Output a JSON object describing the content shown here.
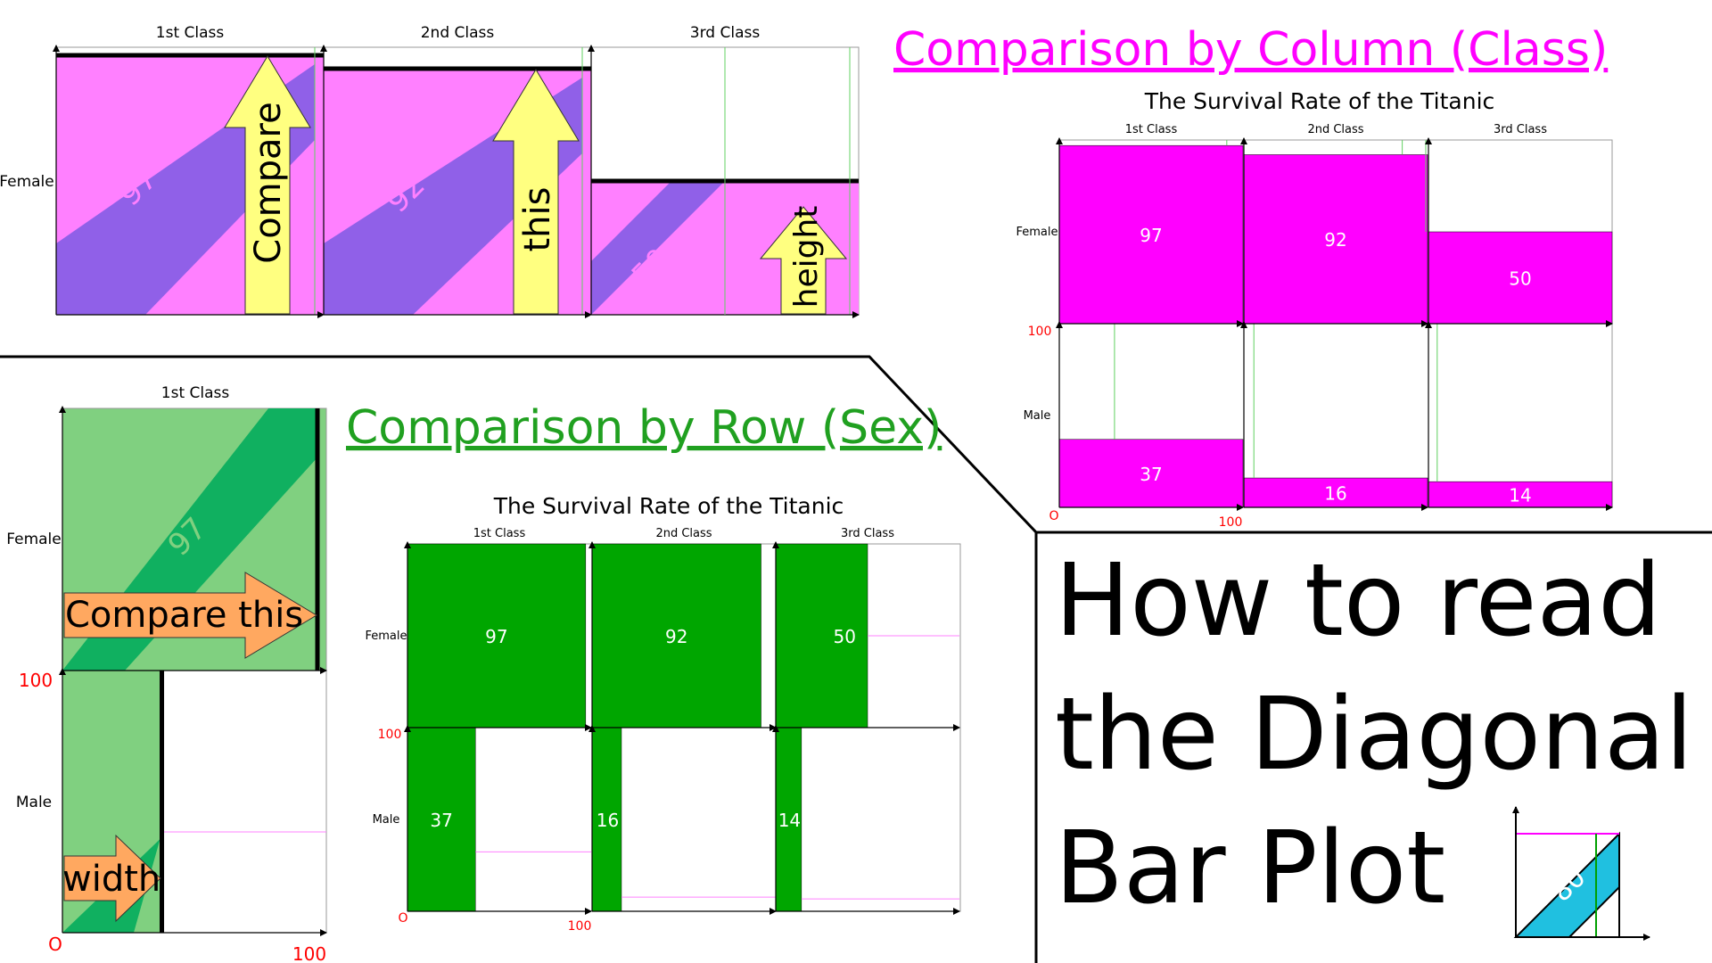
{
  "classes": [
    "1st Class",
    "2nd Class",
    "3rd Class"
  ],
  "sexes": [
    "Female",
    "Male"
  ],
  "axis": {
    "zero": "O",
    "hundred": "100"
  },
  "chart_title": "The Survival Rate of the Titanic",
  "headings": {
    "column": "Comparison by Column (Class)",
    "row": "Comparison by Row (Sex)"
  },
  "arrows": {
    "compare": "Compare",
    "this": "this",
    "height": "height",
    "compare_this": "Compare this",
    "width": "width"
  },
  "title_lines": [
    "How to read",
    "the Diagonal",
    "Bar Plot"
  ],
  "logo_value": "80",
  "colors": {
    "magenta": "#ff00ff",
    "pink_light": "#ff80ff",
    "purple": "#9060e8",
    "green_dark": "#00a600",
    "green_light": "#80d080",
    "green_mid": "#10b060",
    "arrow_yellow": "#ffff80",
    "arrow_orange": "#ffa860",
    "heading_magenta": "#ff00ff",
    "heading_green": "#20a020",
    "red": "#ff0000"
  },
  "chart_data": {
    "type": "bar",
    "title": "The Survival Rate of the Titanic",
    "categories": [
      "1st Class",
      "2nd Class",
      "3rd Class"
    ],
    "series": [
      {
        "name": "Female",
        "values": [
          97,
          92,
          50
        ]
      },
      {
        "name": "Male",
        "values": [
          37,
          16,
          14
        ]
      }
    ],
    "ylim": [
      0,
      100
    ]
  }
}
